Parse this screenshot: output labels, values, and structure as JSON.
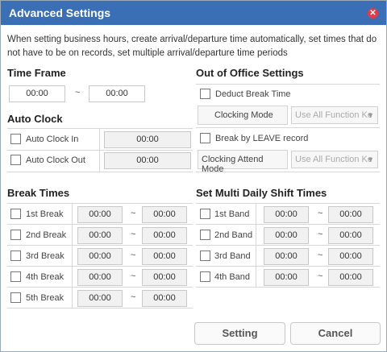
{
  "window": {
    "title": "Advanced Settings",
    "close_icon": "close-icon"
  },
  "description": "When setting business hours, create arrival/departure time automatically, set times that do not have to be on records, set multiple arrival/departure time periods",
  "time_frame": {
    "heading": "Time Frame",
    "start": "00:00",
    "end": "00:00",
    "separator": "~"
  },
  "auto_clock": {
    "heading": "Auto Clock",
    "rows": [
      {
        "label": "Auto Clock In",
        "value": "00:00"
      },
      {
        "label": "Auto Clock Out",
        "value": "00:00"
      }
    ]
  },
  "out_of_office": {
    "heading": "Out of Office Settings",
    "deduct_label": "Deduct Break Time",
    "clocking_mode_label": "Clocking Mode",
    "clocking_mode_value": "Use All Function Ke",
    "break_leave_label": "Break by LEAVE record",
    "attend_mode_label": "Clocking Attend Mode",
    "attend_mode_value": "Use All Function Ke"
  },
  "break_times": {
    "heading": "Break Times",
    "separator": "~",
    "rows": [
      {
        "label": "1st Break",
        "start": "00:00",
        "end": "00:00"
      },
      {
        "label": "2nd Break",
        "start": "00:00",
        "end": "00:00"
      },
      {
        "label": "3rd Break",
        "start": "00:00",
        "end": "00:00"
      },
      {
        "label": "4th Break",
        "start": "00:00",
        "end": "00:00"
      },
      {
        "label": "5th Break",
        "start": "00:00",
        "end": "00:00"
      }
    ]
  },
  "shift_times": {
    "heading": "Set Multi Daily Shift Times",
    "separator": "~",
    "rows": [
      {
        "label": "1st Band",
        "start": "00:00",
        "end": "00:00"
      },
      {
        "label": "2nd Band",
        "start": "00:00",
        "end": "00:00"
      },
      {
        "label": "3rd Band",
        "start": "00:00",
        "end": "00:00"
      },
      {
        "label": "4th Band",
        "start": "00:00",
        "end": "00:00"
      }
    ]
  },
  "footer": {
    "setting_label": "Setting",
    "cancel_label": "Cancel"
  },
  "colors": {
    "titlebar": "#3a6fb5",
    "close": "#e23b48"
  }
}
